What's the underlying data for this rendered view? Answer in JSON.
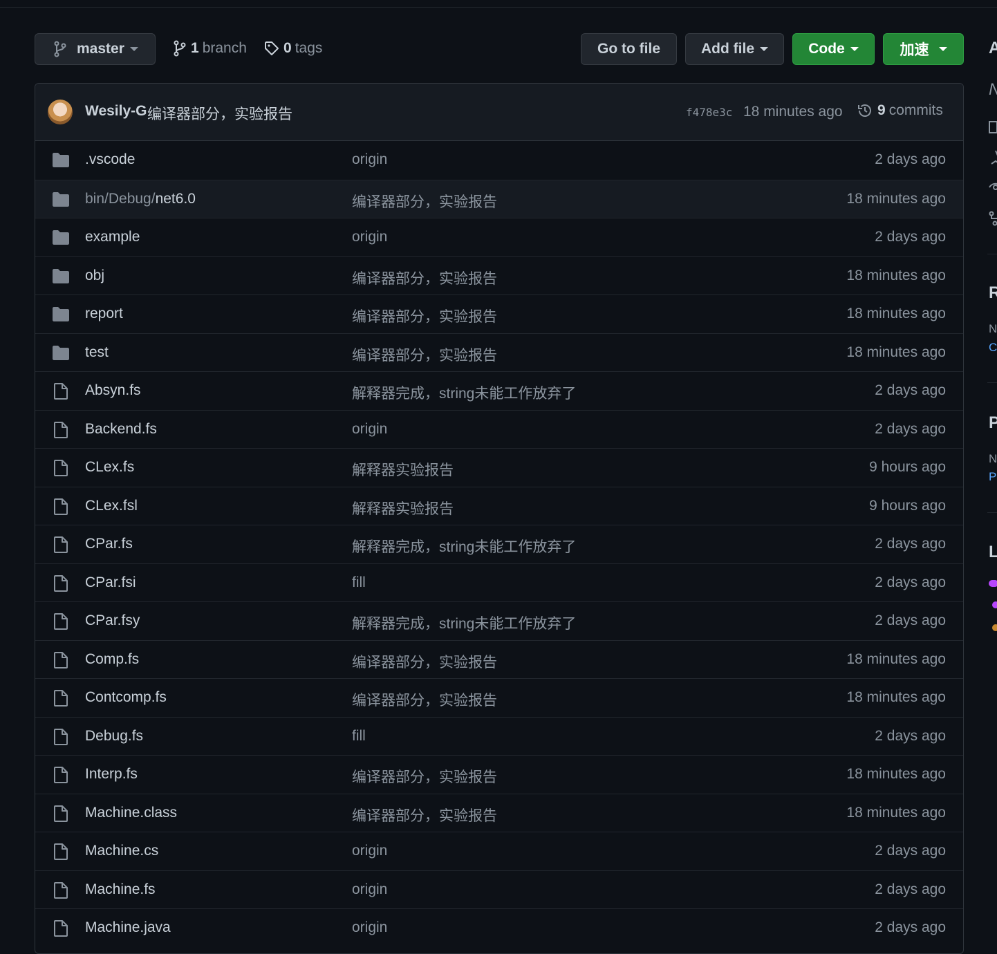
{
  "toolbar": {
    "branch_name": "master",
    "branch_count": "1",
    "branch_label": "branch",
    "tag_count": "0",
    "tag_label": "tags",
    "go_to_file": "Go to file",
    "add_file": "Add file",
    "code": "Code",
    "speedup": "加速"
  },
  "latest_commit": {
    "author": "Wesily-G",
    "message": "编译器部分，实验报告",
    "sha": "f478e3c",
    "time": "18 minutes ago",
    "commit_count": "9",
    "commit_label": "commits"
  },
  "files": [
    {
      "type": "dir",
      "prefix": "",
      "name": ".vscode",
      "message": "origin",
      "age": "2 days ago"
    },
    {
      "type": "dir",
      "prefix": "bin/Debug/",
      "name": "net6.0",
      "message": "编译器部分，实验报告",
      "age": "18 minutes ago"
    },
    {
      "type": "dir",
      "prefix": "",
      "name": "example",
      "message": "origin",
      "age": "2 days ago"
    },
    {
      "type": "dir",
      "prefix": "",
      "name": "obj",
      "message": "编译器部分，实验报告",
      "age": "18 minutes ago"
    },
    {
      "type": "dir",
      "prefix": "",
      "name": "report",
      "message": "编译器部分，实验报告",
      "age": "18 minutes ago"
    },
    {
      "type": "dir",
      "prefix": "",
      "name": "test",
      "message": "编译器部分，实验报告",
      "age": "18 minutes ago"
    },
    {
      "type": "file",
      "prefix": "",
      "name": "Absyn.fs",
      "message": "解释器完成，string未能工作放弃了",
      "age": "2 days ago"
    },
    {
      "type": "file",
      "prefix": "",
      "name": "Backend.fs",
      "message": "origin",
      "age": "2 days ago"
    },
    {
      "type": "file",
      "prefix": "",
      "name": "CLex.fs",
      "message": "解释器实验报告",
      "age": "9 hours ago"
    },
    {
      "type": "file",
      "prefix": "",
      "name": "CLex.fsl",
      "message": "解释器实验报告",
      "age": "9 hours ago"
    },
    {
      "type": "file",
      "prefix": "",
      "name": "CPar.fs",
      "message": "解释器完成，string未能工作放弃了",
      "age": "2 days ago"
    },
    {
      "type": "file",
      "prefix": "",
      "name": "CPar.fsi",
      "message": "fill",
      "age": "2 days ago"
    },
    {
      "type": "file",
      "prefix": "",
      "name": "CPar.fsy",
      "message": "解释器完成，string未能工作放弃了",
      "age": "2 days ago"
    },
    {
      "type": "file",
      "prefix": "",
      "name": "Comp.fs",
      "message": "编译器部分，实验报告",
      "age": "18 minutes ago"
    },
    {
      "type": "file",
      "prefix": "",
      "name": "Contcomp.fs",
      "message": "编译器部分，实验报告",
      "age": "18 minutes ago"
    },
    {
      "type": "file",
      "prefix": "",
      "name": "Debug.fs",
      "message": "fill",
      "age": "2 days ago"
    },
    {
      "type": "file",
      "prefix": "",
      "name": "Interp.fs",
      "message": "编译器部分，实验报告",
      "age": "18 minutes ago"
    },
    {
      "type": "file",
      "prefix": "",
      "name": "Machine.class",
      "message": "编译器部分，实验报告",
      "age": "18 minutes ago"
    },
    {
      "type": "file",
      "prefix": "",
      "name": "Machine.cs",
      "message": "origin",
      "age": "2 days ago"
    },
    {
      "type": "file",
      "prefix": "",
      "name": "Machine.fs",
      "message": "origin",
      "age": "2 days ago"
    },
    {
      "type": "file",
      "prefix": "",
      "name": "Machine.java",
      "message": "origin",
      "age": "2 days ago"
    }
  ],
  "sidebar": {
    "about_initial": "A",
    "about_desc_initial": "N",
    "releases_initial": "R",
    "releases_text_initial": "N",
    "releases_link_initial": "C",
    "packages_initial": "P",
    "packages_text_initial": "N",
    "packages_link_initial": "P",
    "languages_initial": "L"
  },
  "colors": {
    "background": "#0d1117",
    "green_button": "#238636",
    "border": "#30363d",
    "lang_1": "#b845fc",
    "lang_2": "#b845fc",
    "lang_3": "#c6872f"
  }
}
